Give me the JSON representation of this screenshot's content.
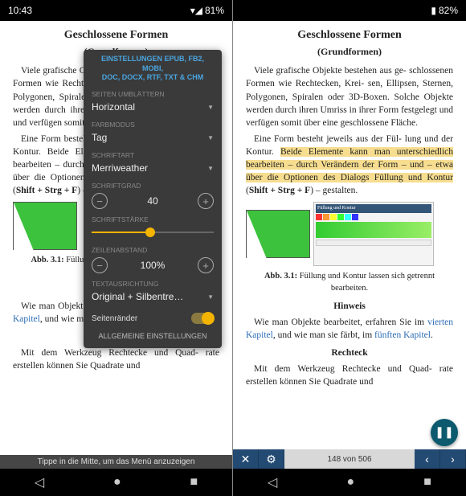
{
  "left": {
    "status": {
      "time": "10:43",
      "battery": "81%"
    },
    "page": {
      "title": "Geschlossene Formen",
      "subtitle": "(Grundformen)",
      "para1a": "Viele grafische Objekte bestehen aus ge-",
      "para1b": "schlossenen Formen wie Rechtecken, Krei- sen, Ellipsen, Sternen, Polygonen, Spiralen oder 3D-Boxen. Solche Objekte werden durch ihren Umriss in ihrer Form festgelegt und verfügen somit über eine geschlossene Fläche.",
      "para2": "Eine Form besteht jeweils aus der Fül- lung und der Kontur. Beide Elemente kann man unterschiedlich bearbeiten – durch Verändern der Form – und – etwa über die Optionen des Dialogs Füllung und Kontur (",
      "para2b": "Shift + Strg + F",
      "para2c": ") – gestalten.",
      "figcap_pre": "Abb. 3.1: ",
      "figcap": "Füllung und Kontur lassen sich getrennt bearbeiten.",
      "hinweis": "Hinweis",
      "para3a": "Wie man Objekte bearbeitet, erfahren Sie im ",
      "link1": "vierten Kapitel",
      "para3b": ", und wie man sie färbt, im ",
      "link2": "fünften Kapitel",
      "rechteck": "Rechteck",
      "para4": "Mit dem Werkzeug Rechtecke und Quad- rate erstellen können Sie Quadrate und"
    },
    "toast": "Tippe in die Mitte, um das Menü anzuzeigen",
    "settings": {
      "title1": "EINSTELLUNGEN EPUB, FB2, MOBI,",
      "title2": "DOC, DOCX, RTF, TXT & CHM",
      "pageturn_label": "SEITEN UMBLÄTTERN",
      "pageturn_value": "Horizontal",
      "colormode_label": "FARBMODUS",
      "colormode_value": "Tag",
      "font_label": "SCHRIFTART",
      "font_value": "Merriweather",
      "fontsize_label": "SCHRIFTGRAD",
      "fontsize_value": "40",
      "fontweight_label": "SCHRIFTSTÄRKE",
      "linespace_label": "ZEILENABSTAND",
      "linespace_value": "100%",
      "textalign_label": "TEXTAUSRICHTUNG",
      "textalign_value": "Original + Silbentre…",
      "margins": "Seitenränder",
      "footer": "ALLGEMEINE EINSTELLUNGEN"
    }
  },
  "right": {
    "status": {
      "battery": "82%"
    },
    "dialog_title": "Füllung und Kontur",
    "bottom": {
      "page": "148 von 506"
    }
  }
}
